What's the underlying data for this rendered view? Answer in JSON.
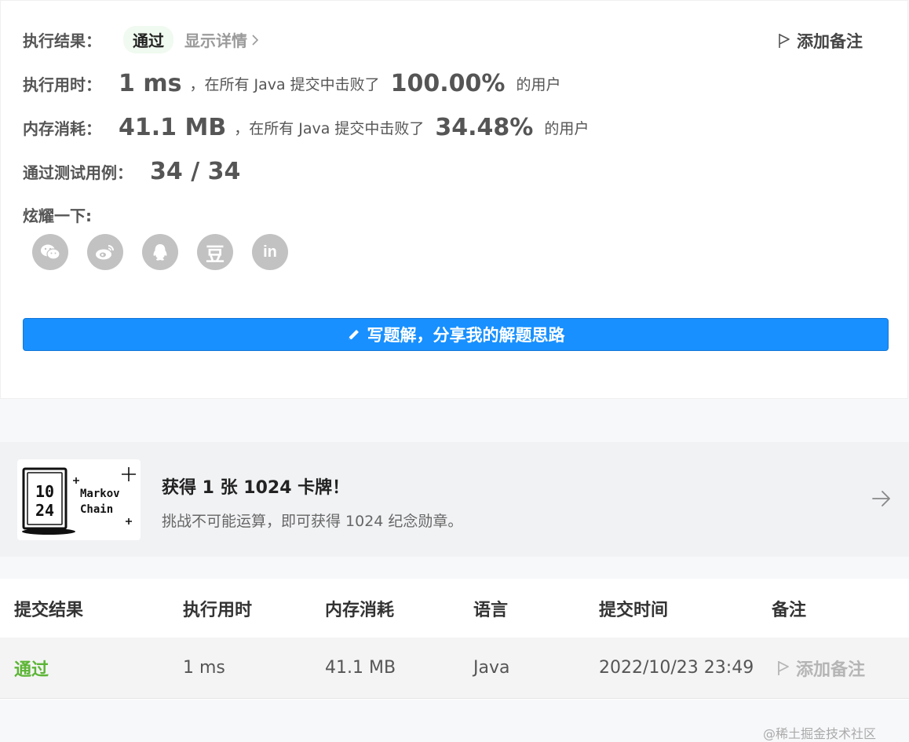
{
  "result": {
    "status_label": "执行结果：",
    "status_value": "通过",
    "detail_link": "显示详情",
    "add_note": "添加备注",
    "runtime_label": "执行用时：",
    "runtime_value": "1 ms",
    "runtime_prefix": "，在所有 Java 提交中击败了",
    "runtime_percent": "100.00%",
    "runtime_suffix": "的用户",
    "memory_label": "内存消耗：",
    "memory_value": "41.1 MB",
    "memory_prefix": "，在所有 Java 提交中击败了",
    "memory_percent": "34.48%",
    "memory_suffix": "的用户",
    "testcases_label": "通过测试用例：",
    "testcases_value": "34 / 34",
    "share_label": "炫耀一下:",
    "share_icons": [
      "wechat-icon",
      "weibo-icon",
      "qq-icon",
      "douban-icon",
      "linkedin-icon"
    ],
    "douban_glyph": "豆",
    "linkedin_glyph": "in",
    "solution_button": "写题解，分享我的解题思路"
  },
  "promo": {
    "card_text_line1": "Markov",
    "card_text_line2": "Chain",
    "card_glyph_top": "10",
    "card_glyph_bottom": "24",
    "title": "获得 1 张 1024 卡牌！",
    "subtitle": "挑战不可能运算，即可获得 1024 纪念勋章。"
  },
  "table": {
    "headers": [
      "提交结果",
      "执行用时",
      "内存消耗",
      "语言",
      "提交时间",
      "备注"
    ],
    "row": {
      "result": "通过",
      "runtime": "1 ms",
      "memory": "41.1 MB",
      "language": "Java",
      "time": "2022/10/23 23:49",
      "note": "添加备注"
    },
    "watermark": "@稀土掘金技术社区"
  },
  "colors": {
    "accent": "#1890ff",
    "pass_green": "#5cb536",
    "icon_gray": "#c2c2c2"
  }
}
